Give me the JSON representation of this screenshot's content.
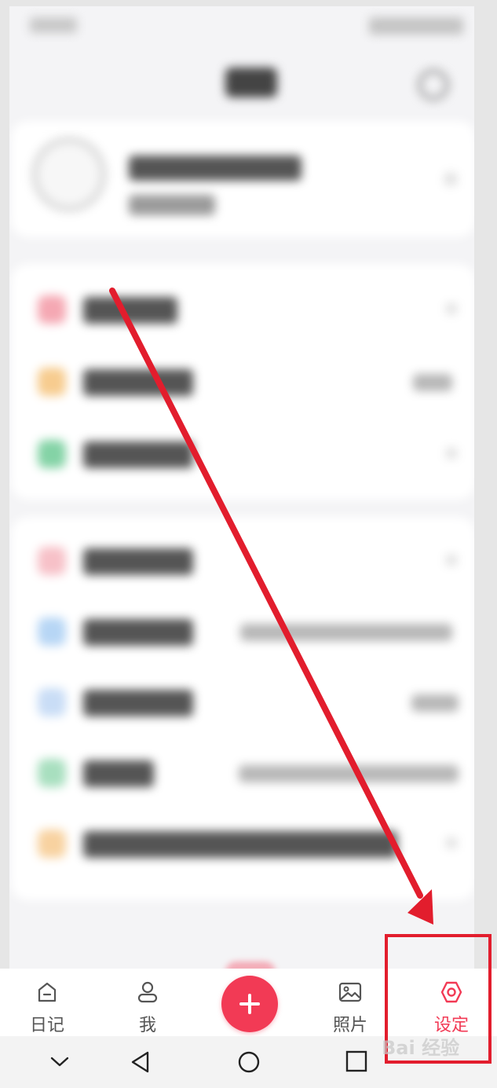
{
  "tabbar": {
    "tabs": [
      {
        "label": "日记",
        "icon": "diary-icon",
        "active": false
      },
      {
        "label": "我",
        "icon": "person-icon",
        "active": false
      },
      {
        "label": "",
        "icon": "plus-icon",
        "active": false
      },
      {
        "label": "照片",
        "icon": "photo-icon",
        "active": false
      },
      {
        "label": "设定",
        "icon": "settings-icon",
        "active": true
      }
    ],
    "active_color": "#f23a55",
    "inactive_color": "#555555"
  },
  "system_nav": {
    "icons": [
      "chevron-down-icon",
      "back-triangle-icon",
      "home-circle-icon",
      "recents-square-icon"
    ]
  },
  "watermark": {
    "text": "Bai 经验"
  },
  "colors": {
    "annotation_red": "#e21d2d",
    "background": "#f4f4f6"
  }
}
